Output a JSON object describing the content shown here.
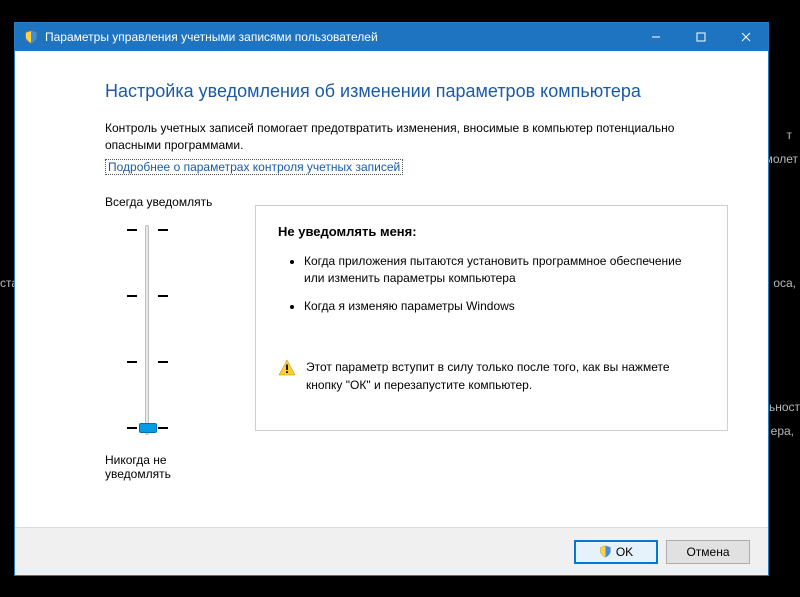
{
  "background_snippets": [
    "т",
    "молет",
    "ста",
    "оса,",
    "ьност",
    "ера,"
  ],
  "titlebar": {
    "title": "Параметры управления учетными записями пользователей"
  },
  "content": {
    "heading": "Настройка уведомления об изменении параметров компьютера",
    "description": "Контроль учетных записей помогает предотвратить изменения, вносимые в компьютер потенциально опасными программами.",
    "link": "Подробнее о параметрах контроля учетных записей"
  },
  "slider": {
    "top_label": "Всегда уведомлять",
    "bottom_label": "Никогда не уведомлять",
    "levels": 4,
    "current_level": 0
  },
  "panel": {
    "title": "Не уведомлять меня:",
    "bullets": [
      "Когда приложения пытаются установить программное обеспечение или изменить параметры компьютера",
      "Когда я изменяю параметры Windows"
    ],
    "warning": "Этот параметр вступит в силу только после того, как вы нажмете кнопку \"ОК\" и перезапустите компьютер."
  },
  "buttons": {
    "ok": "OK",
    "cancel": "Отмена"
  }
}
